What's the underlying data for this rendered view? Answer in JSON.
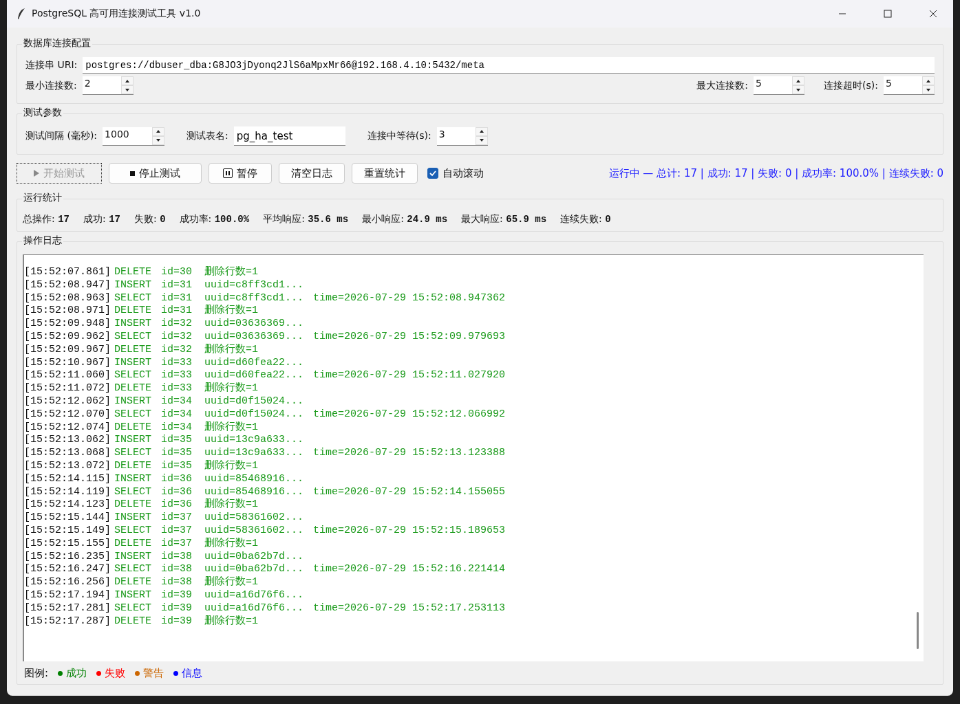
{
  "window": {
    "title": "PostgreSQL 高可用连接测试工具 v1.0"
  },
  "connection": {
    "title": "数据库连接配置",
    "uri_label": "连接串 URI:",
    "uri": "postgres://dbuser_dba:G8JO3jDyonq2JlS6aMpxMr66@192.168.4.10:5432/meta",
    "min_label": "最小连接数:",
    "min": "2",
    "max_label": "最大连接数:",
    "max": "5",
    "timeout_label": "连接超时(s):",
    "timeout": "5"
  },
  "params": {
    "title": "测试参数",
    "interval_label": "测试间隔 (毫秒):",
    "interval": "1000",
    "table_label": "测试表名:",
    "table": "pg_ha_test",
    "wait_label": "连接中等待(s):",
    "wait": "3"
  },
  "buttons": [
    {
      "label": "开始测试",
      "kind": "start",
      "disabled": true
    },
    {
      "label": "停止测试",
      "kind": "stop",
      "disabled": false
    },
    {
      "label": "暂停",
      "kind": "pause",
      "disabled": false
    },
    {
      "label": "清空日志",
      "kind": "plain",
      "disabled": false
    },
    {
      "label": "重置统计",
      "kind": "plain",
      "disabled": false
    }
  ],
  "auto_scroll": {
    "label": "自动滚动",
    "checked": true
  },
  "status": "运行中 — 总计: 17 | 成功: 17 | 失败: 0 | 成功率: 100.0% | 连续失败: 0",
  "stats": {
    "title": "运行统计",
    "items": [
      {
        "label": "总操作:",
        "value": "17"
      },
      {
        "label": "成功:",
        "value": "17"
      },
      {
        "label": "失败:",
        "value": "0"
      },
      {
        "label": "成功率:",
        "value": "100.0%"
      },
      {
        "label": "平均响应:",
        "value": "35.6 ms"
      },
      {
        "label": "最小响应:",
        "value": "24.9 ms"
      },
      {
        "label": "最大响应:",
        "value": "65.9 ms"
      },
      {
        "label": "连续失败:",
        "value": "0"
      }
    ]
  },
  "log": {
    "title": "操作日志",
    "lines": [
      {
        "time": "[15:52:07.861]",
        "op": "DELETE",
        "id": "id=30",
        "detail": "删除行数=1"
      },
      {
        "time": "[15:52:08.947]",
        "op": "INSERT",
        "id": "id=31",
        "detail": "uuid=c8ff3cd1..."
      },
      {
        "time": "[15:52:08.963]",
        "op": "SELECT",
        "id": "id=31",
        "detail": "uuid=c8ff3cd1...",
        "extra": "time=2026-07-29 15:52:08.947362"
      },
      {
        "time": "[15:52:08.971]",
        "op": "DELETE",
        "id": "id=31",
        "detail": "删除行数=1"
      },
      {
        "time": "[15:52:09.948]",
        "op": "INSERT",
        "id": "id=32",
        "detail": "uuid=03636369..."
      },
      {
        "time": "[15:52:09.962]",
        "op": "SELECT",
        "id": "id=32",
        "detail": "uuid=03636369...",
        "extra": "time=2026-07-29 15:52:09.979693"
      },
      {
        "time": "[15:52:09.967]",
        "op": "DELETE",
        "id": "id=32",
        "detail": "删除行数=1"
      },
      {
        "time": "[15:52:10.967]",
        "op": "INSERT",
        "id": "id=33",
        "detail": "uuid=d60fea22..."
      },
      {
        "time": "[15:52:11.060]",
        "op": "SELECT",
        "id": "id=33",
        "detail": "uuid=d60fea22...",
        "extra": "time=2026-07-29 15:52:11.027920"
      },
      {
        "time": "[15:52:11.072]",
        "op": "DELETE",
        "id": "id=33",
        "detail": "删除行数=1"
      },
      {
        "time": "[15:52:12.062]",
        "op": "INSERT",
        "id": "id=34",
        "detail": "uuid=d0f15024..."
      },
      {
        "time": "[15:52:12.070]",
        "op": "SELECT",
        "id": "id=34",
        "detail": "uuid=d0f15024...",
        "extra": "time=2026-07-29 15:52:12.066992"
      },
      {
        "time": "[15:52:12.074]",
        "op": "DELETE",
        "id": "id=34",
        "detail": "删除行数=1"
      },
      {
        "time": "[15:52:13.062]",
        "op": "INSERT",
        "id": "id=35",
        "detail": "uuid=13c9a633..."
      },
      {
        "time": "[15:52:13.068]",
        "op": "SELECT",
        "id": "id=35",
        "detail": "uuid=13c9a633...",
        "extra": "time=2026-07-29 15:52:13.123388"
      },
      {
        "time": "[15:52:13.072]",
        "op": "DELETE",
        "id": "id=35",
        "detail": "删除行数=1"
      },
      {
        "time": "[15:52:14.115]",
        "op": "INSERT",
        "id": "id=36",
        "detail": "uuid=85468916..."
      },
      {
        "time": "[15:52:14.119]",
        "op": "SELECT",
        "id": "id=36",
        "detail": "uuid=85468916...",
        "extra": "time=2026-07-29 15:52:14.155055"
      },
      {
        "time": "[15:52:14.123]",
        "op": "DELETE",
        "id": "id=36",
        "detail": "删除行数=1"
      },
      {
        "time": "[15:52:15.144]",
        "op": "INSERT",
        "id": "id=37",
        "detail": "uuid=58361602..."
      },
      {
        "time": "[15:52:15.149]",
        "op": "SELECT",
        "id": "id=37",
        "detail": "uuid=58361602...",
        "extra": "time=2026-07-29 15:52:15.189653"
      },
      {
        "time": "[15:52:15.155]",
        "op": "DELETE",
        "id": "id=37",
        "detail": "删除行数=1"
      },
      {
        "time": "[15:52:16.235]",
        "op": "INSERT",
        "id": "id=38",
        "detail": "uuid=0ba62b7d..."
      },
      {
        "time": "[15:52:16.247]",
        "op": "SELECT",
        "id": "id=38",
        "detail": "uuid=0ba62b7d...",
        "extra": "time=2026-07-29 15:52:16.221414"
      },
      {
        "time": "[15:52:16.256]",
        "op": "DELETE",
        "id": "id=38",
        "detail": "删除行数=1"
      },
      {
        "time": "[15:52:17.194]",
        "op": "INSERT",
        "id": "id=39",
        "detail": "uuid=a16d76f6..."
      },
      {
        "time": "[15:52:17.281]",
        "op": "SELECT",
        "id": "id=39",
        "detail": "uuid=a16d76f6...",
        "extra": "time=2026-07-29 15:52:17.253113"
      },
      {
        "time": "[15:52:17.287]",
        "op": "DELETE",
        "id": "id=39",
        "detail": "删除行数=1"
      }
    ]
  },
  "legend": {
    "label": "图例:",
    "items": [
      {
        "label": "成功",
        "color": "#008000"
      },
      {
        "label": "失败",
        "color": "#ff0000"
      },
      {
        "label": "警告",
        "color": "#cc6600"
      },
      {
        "label": "信息",
        "color": "#0000ff"
      }
    ]
  }
}
